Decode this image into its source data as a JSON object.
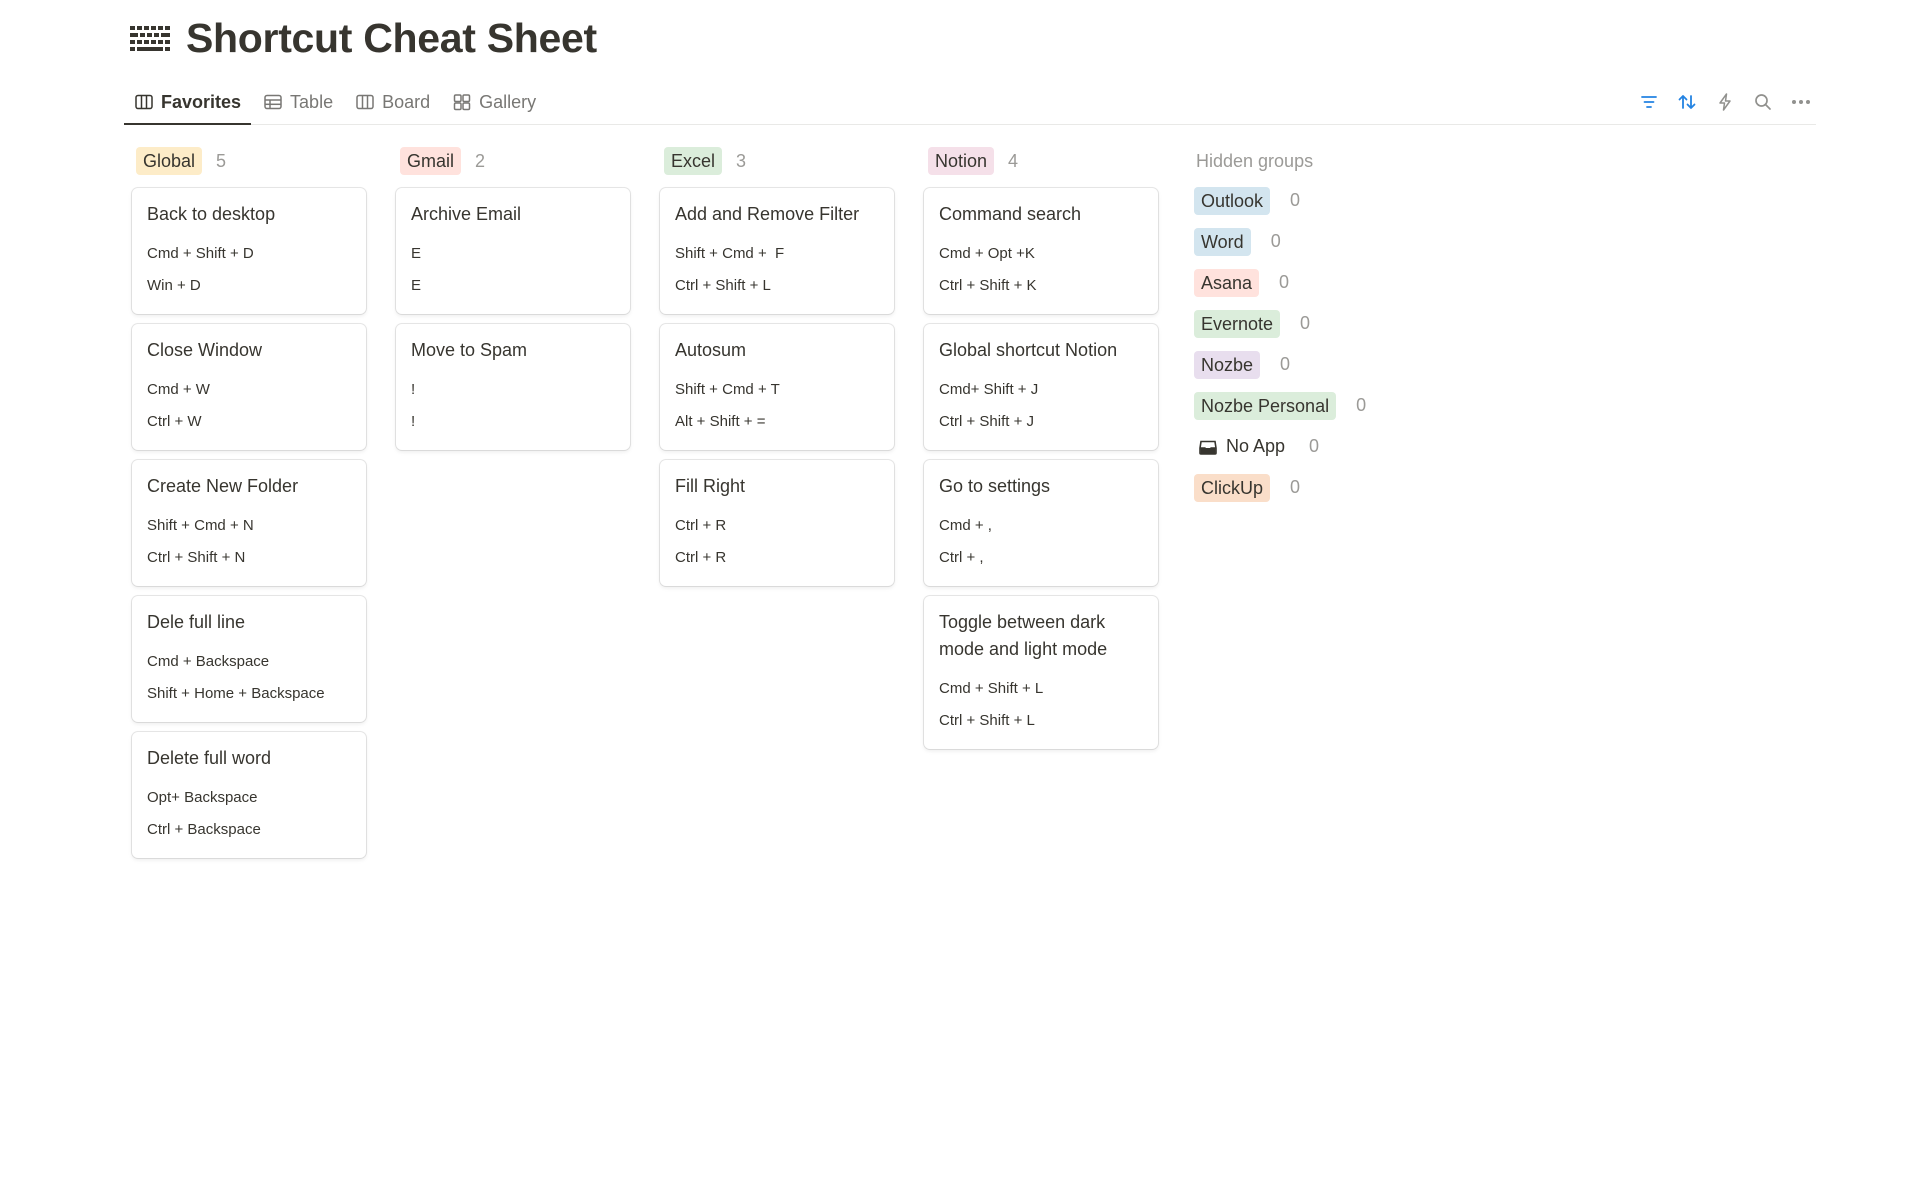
{
  "page": {
    "title": "Shortcut Cheat Sheet",
    "icon": "keyboard-icon"
  },
  "views": {
    "tabs": [
      {
        "label": "Favorites",
        "icon": "board-icon",
        "active": true
      },
      {
        "label": "Table",
        "icon": "table-icon",
        "active": false
      },
      {
        "label": "Board",
        "icon": "board-icon",
        "active": false
      },
      {
        "label": "Gallery",
        "icon": "gallery-icon",
        "active": false
      }
    ],
    "tools": [
      "filter-icon",
      "sort-icon",
      "automation-bolt-icon",
      "search-icon",
      "more-icon"
    ],
    "accent_color": "#2383e2"
  },
  "columns": [
    {
      "tag": "Global",
      "tag_bg": "#fdecc8",
      "count": "5",
      "cards": [
        {
          "title": "Back to desktop",
          "mac": "Cmd + Shift + D",
          "win": "Win + D"
        },
        {
          "title": "Close Window",
          "mac": "Cmd + W",
          "win": "Ctrl + W"
        },
        {
          "title": "Create New Folder",
          "mac": "Shift + Cmd + N",
          "win": "Ctrl + Shift + N"
        },
        {
          "title": "Dele full line",
          "mac": "Cmd + Backspace",
          "win": "Shift + Home + Backspace"
        },
        {
          "title": "Delete full word",
          "mac": "Opt+ Backspace",
          "win": "Ctrl + Backspace"
        }
      ]
    },
    {
      "tag": "Gmail",
      "tag_bg": "#ffe2dd",
      "count": "2",
      "cards": [
        {
          "title": "Archive Email",
          "mac": "E",
          "win": "E"
        },
        {
          "title": "Move to Spam",
          "mac": "!",
          "win": "!"
        }
      ]
    },
    {
      "tag": "Excel",
      "tag_bg": "#dbeddb",
      "count": "3",
      "cards": [
        {
          "title": "Add and Remove Filter",
          "mac": "Shift + Cmd +  F",
          "win": "Ctrl + Shift + L"
        },
        {
          "title": "Autosum",
          "mac": "Shift + Cmd + T",
          "win": "Alt + Shift + ="
        },
        {
          "title": "Fill Right",
          "mac": "Ctrl + R",
          "win": "Ctrl + R"
        }
      ]
    },
    {
      "tag": "Notion",
      "tag_bg": "#f5e0e9",
      "count": "4",
      "cards": [
        {
          "title": "Command search",
          "mac": "Cmd + Opt +K",
          "win": "Ctrl + Shift + K"
        },
        {
          "title": "Global shortcut Notion",
          "mac": "Cmd+ Shift + J",
          "win": "Ctrl + Shift + J"
        },
        {
          "title": "Go to settings",
          "mac": "Cmd + ,",
          "win": "Ctrl + ,"
        },
        {
          "title": "Toggle between dark mode and light mode",
          "mac": "Cmd + Shift + L",
          "win": "Ctrl + Shift + L"
        }
      ]
    }
  ],
  "hidden_groups": {
    "title": "Hidden groups",
    "items": [
      {
        "label": "Outlook",
        "bg": "#d3e5ef",
        "count": "0"
      },
      {
        "label": "Word",
        "bg": "#d3e5ef",
        "count": "0"
      },
      {
        "label": "Asana",
        "bg": "#ffe2dd",
        "count": "0"
      },
      {
        "label": "Evernote",
        "bg": "#dbeddb",
        "count": "0"
      },
      {
        "label": "Nozbe",
        "bg": "#e8deee",
        "count": "0"
      },
      {
        "label": "Nozbe Personal",
        "bg": "#dbeddb",
        "count": "0"
      },
      {
        "label": "No App",
        "bg": "",
        "count": "0",
        "icon": "inbox-icon"
      },
      {
        "label": "ClickUp",
        "bg": "#fadec9",
        "count": "0"
      }
    ]
  }
}
